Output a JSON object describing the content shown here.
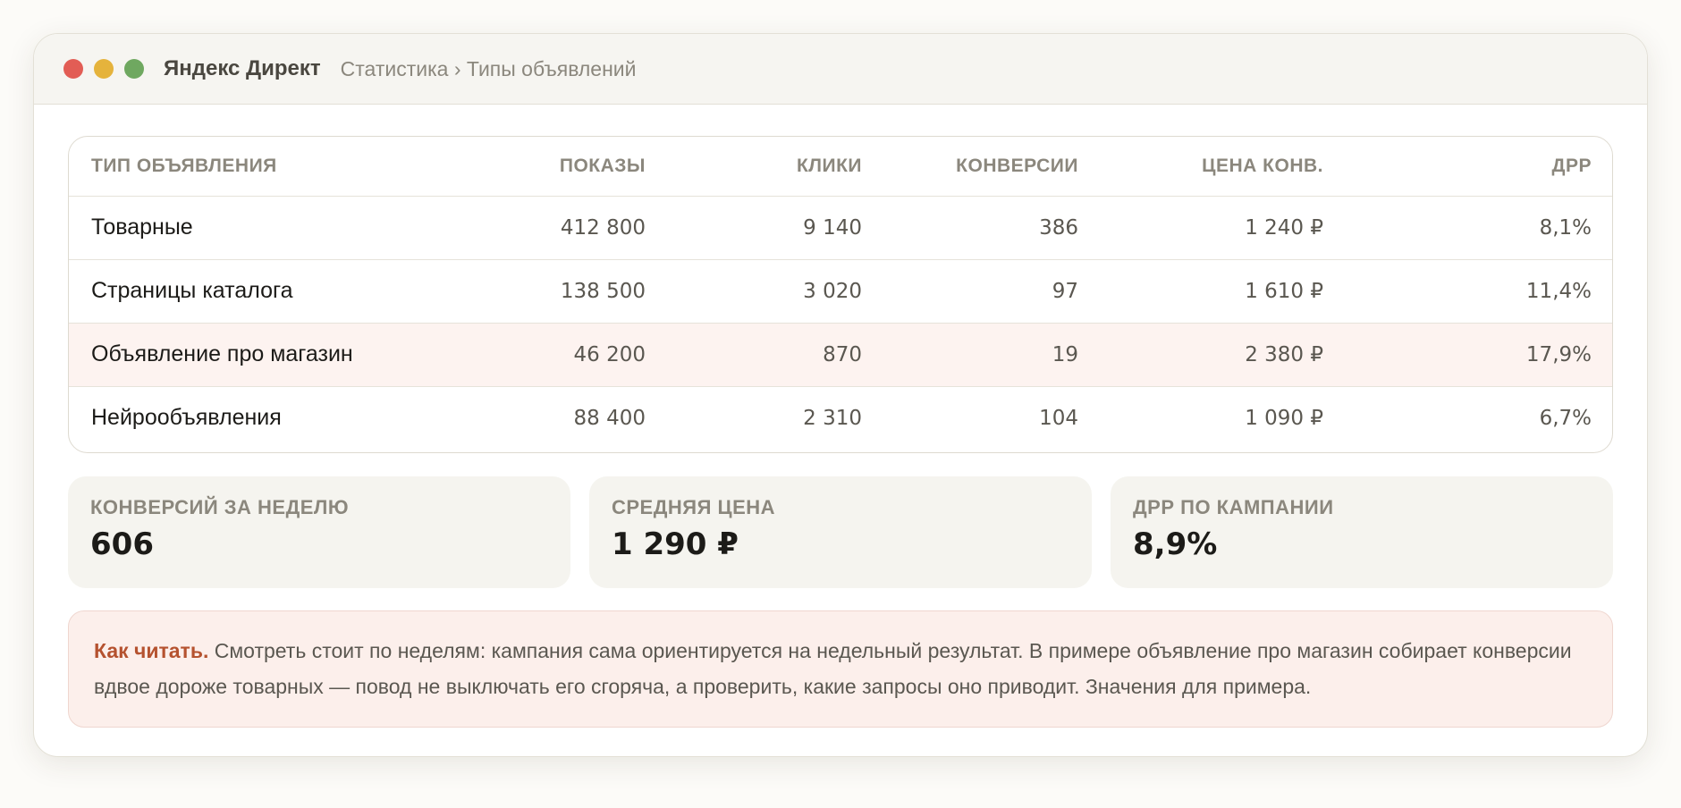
{
  "window": {
    "app_title": "Яндекс Директ",
    "breadcrumb": "Статистика › Типы объявлений"
  },
  "table": {
    "columns": [
      "ТИП ОБЪЯВЛЕНИЯ",
      "ПОКАЗЫ",
      "КЛИКИ",
      "КОНВЕРСИИ",
      "ЦЕНА КОНВ.",
      "ДРР"
    ],
    "rows": [
      [
        "Товарные",
        "412 800",
        "9 140",
        "386",
        "1 240 ₽",
        "8,1%"
      ],
      [
        "Страницы каталога",
        "138 500",
        "3 020",
        "97",
        "1 610 ₽",
        "11,4%"
      ],
      [
        "Объявление про магазин",
        "46 200",
        "870",
        "19",
        "2 380 ₽",
        "17,9%"
      ],
      [
        "Нейрообъявления",
        "88 400",
        "2 310",
        "104",
        "1 090 ₽",
        "6,7%"
      ]
    ]
  },
  "stats": [
    {
      "label": "КОНВЕРСИЙ ЗА НЕДЕЛЮ",
      "value": "606"
    },
    {
      "label": "СРЕДНЯЯ ЦЕНА",
      "value": "1 290 ₽"
    },
    {
      "label": "ДРР ПО КАМПАНИИ",
      "value": "8,9%"
    }
  ],
  "note": {
    "title": "Как читать.",
    "text": " Смотреть стоит по неделям: кампания сама ориентируется на недельный результат. В примере объявление про магазин собирает конверсии вдвое дороже товарных — повод не выключать его сгоряча, а проверить, какие запросы оно приводит. Значения для примера."
  },
  "colors": {
    "highlight_row": "#fdf3f0",
    "note_accent": "#b5522f",
    "dot_red": "#e25d55",
    "dot_yellow": "#e5b33c",
    "dot_green": "#6fa860"
  }
}
